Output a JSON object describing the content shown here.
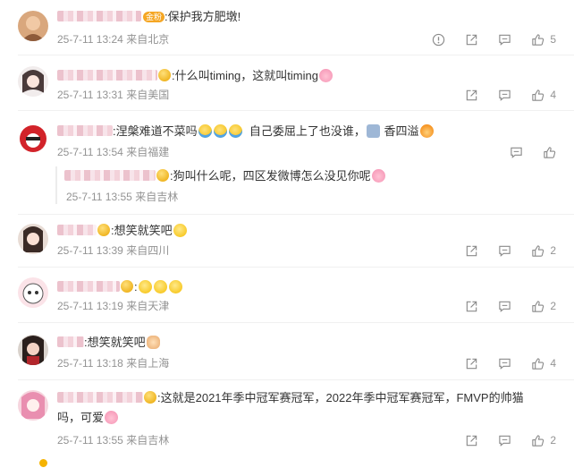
{
  "comments": [
    {
      "text": ":保护我方肥墩!",
      "time": "25-7-11 13:24",
      "location": "来自北京",
      "likes": "5",
      "badge": "金粉"
    },
    {
      "text": ":什么叫timing，这就叫timing",
      "time": "25-7-11 13:31",
      "location": "来自美国",
      "likes": "4"
    },
    {
      "text": ":涅槃难道不菜吗",
      "text2": "自己委屈上了也没谁，",
      "text3": "香四溢",
      "time": "25-7-11 13:54",
      "location": "来自福建",
      "likes": ""
    },
    {
      "text": ":想笑就笑吧",
      "time": "25-7-11 13:39",
      "location": "来自四川",
      "likes": "2"
    },
    {
      "text": ":",
      "time": "25-7-11 13:19",
      "location": "来自天津",
      "likes": "2"
    },
    {
      "text": ":想笑就笑吧",
      "time": "25-7-11 13:18",
      "location": "来自上海",
      "likes": "4"
    },
    {
      "text": ":这就是2021年季中冠军赛冠军，2022年季中冠军赛冠军，FMVP的帅猫",
      "text2": "吗，可爱",
      "time": "25-7-11 13:55",
      "location": "来自吉林",
      "likes": "2"
    }
  ],
  "reply": {
    "text": ":狗叫什么呢，四区发微博怎么没见你呢",
    "time": "25-7-11 13:55",
    "location": "来自吉林"
  },
  "icons": [
    "report-icon",
    "share-icon",
    "comment-icon",
    "like-icon"
  ]
}
